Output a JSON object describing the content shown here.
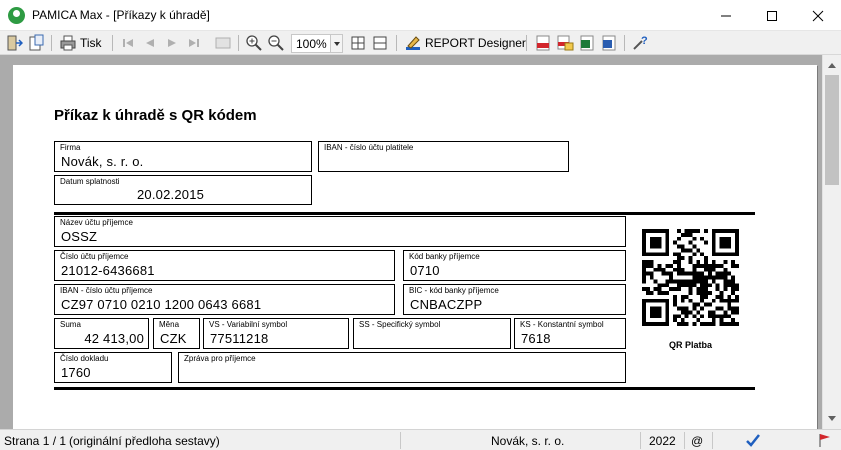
{
  "window": {
    "title": "PAMICA Max - [Příkazy k úhradě]"
  },
  "toolbar": {
    "print_label": "Tisk",
    "zoom_value": "100%",
    "report_designer_label": "REPORT Designer"
  },
  "form": {
    "title": "Příkaz k úhradě s QR kódem",
    "firma": {
      "label": "Firma",
      "value": "Novák, s. r. o."
    },
    "iban_platitele": {
      "label": "IBAN - číslo účtu platitele",
      "value": ""
    },
    "datum_splatnosti": {
      "label": "Datum splatnosti",
      "value": "20.02.2015"
    },
    "nazev_uctu_prijemce": {
      "label": "Název účtu příjemce",
      "value": "OSSZ"
    },
    "cislo_uctu_prijemce": {
      "label": "Číslo účtu příjemce",
      "value": "21012-6436681"
    },
    "kod_banky_prijemce": {
      "label": "Kód banky příjemce",
      "value": "0710"
    },
    "iban_prijemce": {
      "label": "IBAN - číslo účtu příjemce",
      "value": "CZ97 0710 0210 1200 0643 6681"
    },
    "bic_prijemce": {
      "label": "BIC - kód banky příjemce",
      "value": "CNBACZPP"
    },
    "suma": {
      "label": "Suma",
      "value": "42 413,00"
    },
    "mena": {
      "label": "Měna",
      "value": "CZK"
    },
    "vs": {
      "label": "VS - Variabilní symbol",
      "value": "77511218"
    },
    "ss": {
      "label": "SS - Specifický symbol",
      "value": ""
    },
    "ks": {
      "label": "KS - Konstantní symbol",
      "value": "7618"
    },
    "cislo_dokladu": {
      "label": "Číslo dokladu",
      "value": "1760"
    },
    "zprava_pro_prijemce": {
      "label": "Zpráva pro příjemce",
      "value": ""
    },
    "qr_caption": "QR Platba"
  },
  "statusbar": {
    "page": "Strana 1 / 1",
    "template": "(originální předloha sestavy)",
    "company": "Novák, s. r. o.",
    "year": "2022",
    "at_symbol": "@"
  },
  "colors": {
    "app_green": "#2e9b43",
    "preview_background": "#ababab",
    "toolbar_background": "#f0f0f0"
  }
}
